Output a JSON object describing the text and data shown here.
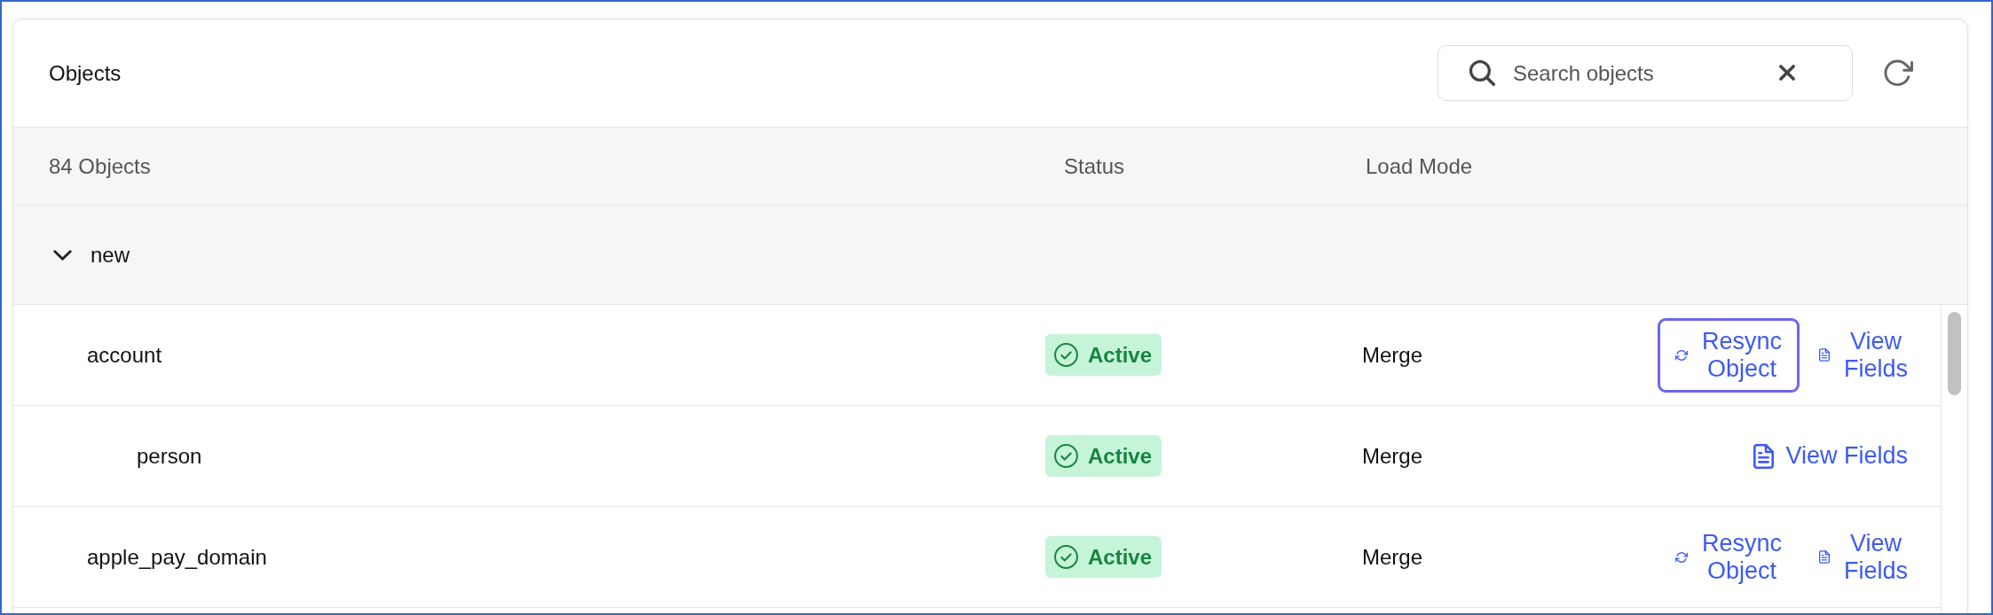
{
  "panel": {
    "title": "Objects",
    "search": {
      "placeholder": "Search objects"
    }
  },
  "table": {
    "columns": [
      "84 Objects",
      "Status",
      "Load Mode"
    ],
    "groups": [
      {
        "label": "new",
        "expanded": true,
        "rows": [
          {
            "name": "account",
            "status": "Active",
            "load_mode": "Merge",
            "actions": [
              {
                "kind": "resync",
                "label": "Resync Object",
                "focused": true
              },
              {
                "kind": "view",
                "label": "View Fields",
                "focused": false
              }
            ],
            "children": [
              {
                "name": "person",
                "status": "Active",
                "load_mode": "Merge",
                "actions": [
                  {
                    "kind": "view",
                    "label": "View Fields",
                    "focused": false
                  }
                ]
              }
            ]
          },
          {
            "name": "apple_pay_domain",
            "status": "Active",
            "load_mode": "Merge",
            "actions": [
              {
                "kind": "resync",
                "label": "Resync Object",
                "focused": false
              },
              {
                "kind": "view",
                "label": "View Fields",
                "focused": false
              }
            ]
          }
        ]
      }
    ]
  }
}
